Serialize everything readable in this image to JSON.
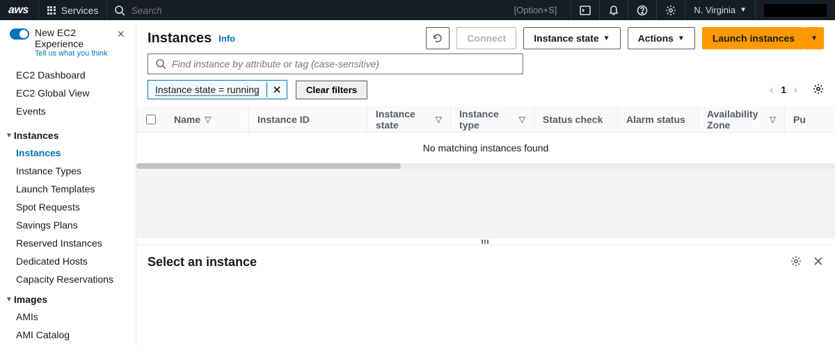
{
  "topnav": {
    "logo": "aws",
    "services": "Services",
    "search_placeholder": "Search",
    "search_hint": "[Option+S]",
    "region": "N. Virginia"
  },
  "new_experience": {
    "title": "New EC2 Experience",
    "subtitle": "Tell us what you think"
  },
  "sidebar": {
    "top": [
      "EC2 Dashboard",
      "EC2 Global View",
      "Events"
    ],
    "sections": [
      {
        "header": "Instances",
        "items": [
          "Instances",
          "Instance Types",
          "Launch Templates",
          "Spot Requests",
          "Savings Plans",
          "Reserved Instances",
          "Dedicated Hosts",
          "Capacity Reservations"
        ],
        "active_index": 0
      },
      {
        "header": "Images",
        "items": [
          "AMIs",
          "AMI Catalog"
        ]
      }
    ]
  },
  "page": {
    "title": "Instances",
    "info": "Info",
    "connect": "Connect",
    "instance_state": "Instance state",
    "actions": "Actions",
    "launch": "Launch instances"
  },
  "search": {
    "placeholder": "Find instance by attribute or tag (case-sensitive)"
  },
  "filters": {
    "chip": "Instance state = running",
    "clear": "Clear filters"
  },
  "pager": {
    "page": "1"
  },
  "table": {
    "columns": [
      "Name",
      "Instance ID",
      "Instance state",
      "Instance type",
      "Status check",
      "Alarm status",
      "Availability Zone",
      "Pu"
    ],
    "empty": "No matching instances found"
  },
  "detail": {
    "title": "Select an instance"
  }
}
